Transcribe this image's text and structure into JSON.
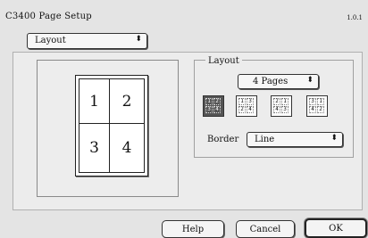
{
  "window": {
    "title": "C3400 Page Setup",
    "version": "1.0.1"
  },
  "section_popup": {
    "value": "Layout",
    "arrow": "⬍"
  },
  "preview": {
    "pages": [
      "1",
      "2",
      "3",
      "4"
    ]
  },
  "layout_group": {
    "label": "Layout",
    "pages_popup": {
      "value": "4 Pages",
      "arrow": "⬍"
    },
    "order_icons": [
      {
        "name": "order-left-right-top-bottom",
        "cells": [
          "1",
          "2",
          "3",
          "4"
        ],
        "selected": true
      },
      {
        "name": "order-top-bottom-left-right",
        "cells": [
          "1",
          "3",
          "2",
          "4"
        ],
        "selected": false
      },
      {
        "name": "order-right-left-top-bottom",
        "cells": [
          "2",
          "1",
          "4",
          "3"
        ],
        "selected": false
      },
      {
        "name": "order-top-bottom-right-left",
        "cells": [
          "3",
          "1",
          "4",
          "2"
        ],
        "selected": false
      }
    ],
    "border_label": "Border",
    "border_popup": {
      "value": "Line",
      "arrow": "⬍"
    }
  },
  "buttons": {
    "help": "Help",
    "cancel": "Cancel",
    "ok": "OK"
  }
}
